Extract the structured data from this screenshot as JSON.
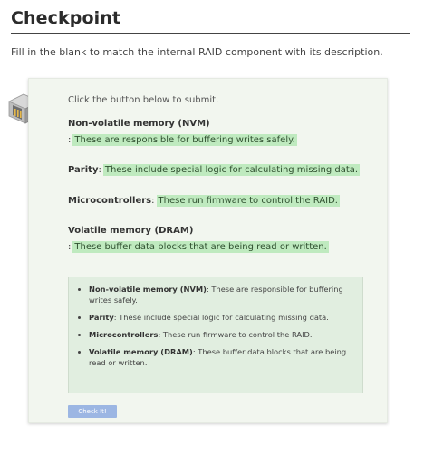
{
  "page": {
    "title": "Checkpoint",
    "instructions": "Fill in the blank to match the internal RAID component with its description."
  },
  "card": {
    "hint": "Click the button below to submit.",
    "items": [
      {
        "term": "Non-volatile memory (NVM)",
        "separator": ":",
        "answer": "These are responsible for buffering writes safely."
      },
      {
        "term": "Parity",
        "separator": ":",
        "answer": "These include special logic for calculating missing data."
      },
      {
        "term": "Microcontrollers",
        "separator": ":",
        "answer": "These run firmware to control the RAID."
      },
      {
        "term": "Volatile memory (DRAM)",
        "separator": ":",
        "answer": "These buffer data blocks that are being read or written."
      }
    ],
    "summary": [
      {
        "term": "Non-volatile memory (NVM)",
        "desc": ": These are responsible for buffering writes safely."
      },
      {
        "term": "Parity",
        "desc": ": These include special logic for calculating missing data."
      },
      {
        "term": "Microcontrollers",
        "desc": ": These run firmware to control the RAID."
      },
      {
        "term": "Volatile memory (DRAM)",
        "desc": ": These buffer data blocks that are being read or written."
      }
    ],
    "button_label": "Check It!"
  }
}
